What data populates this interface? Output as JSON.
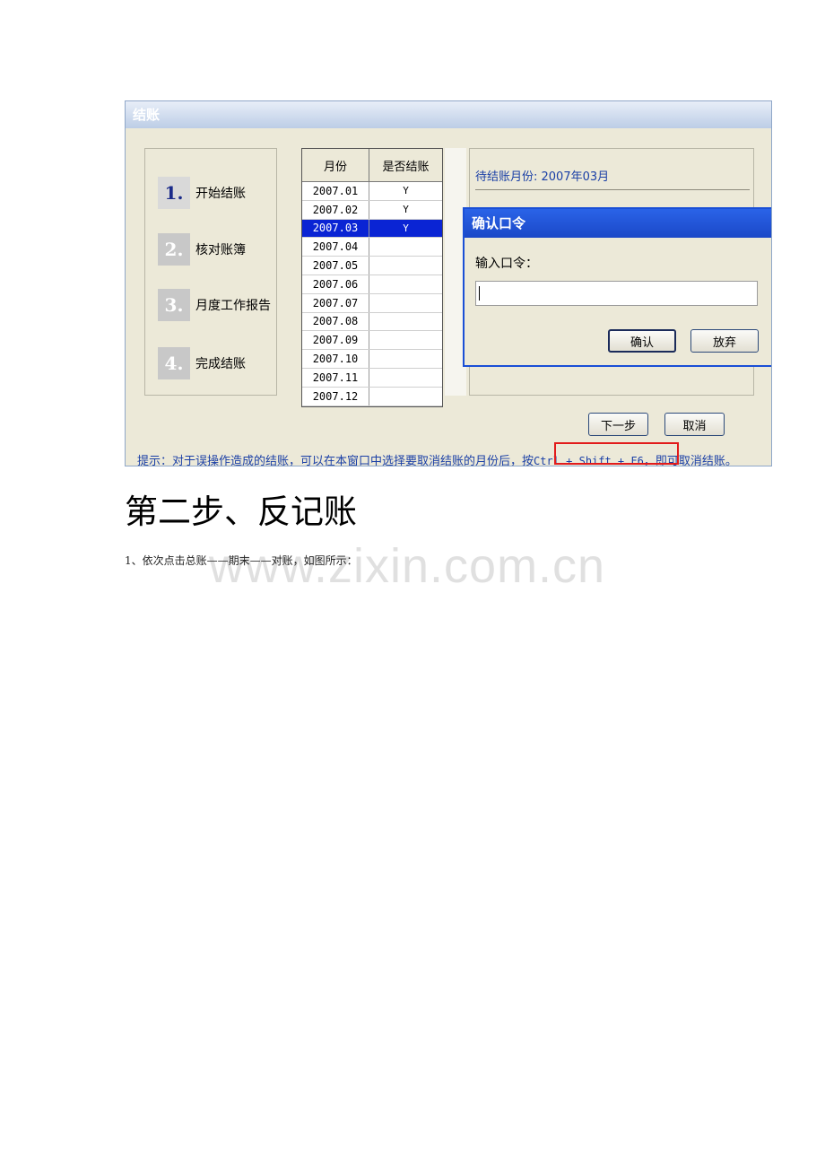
{
  "window": {
    "title": "结账",
    "steps": [
      {
        "num": "1.",
        "label": "开始结账",
        "active": true
      },
      {
        "num": "2.",
        "label": "核对账簿",
        "active": false
      },
      {
        "num": "3.",
        "label": "月度工作报告",
        "active": false
      },
      {
        "num": "4.",
        "label": "完成结账",
        "active": false
      }
    ],
    "table": {
      "headers": [
        "月份",
        "是否结账"
      ],
      "rows": [
        {
          "month": "2007.01",
          "closed": "Y"
        },
        {
          "month": "2007.02",
          "closed": "Y"
        },
        {
          "month": "2007.03",
          "closed": "Y"
        },
        {
          "month": "2007.04",
          "closed": ""
        },
        {
          "month": "2007.05",
          "closed": ""
        },
        {
          "month": "2007.06",
          "closed": ""
        },
        {
          "month": "2007.07",
          "closed": ""
        },
        {
          "month": "2007.08",
          "closed": ""
        },
        {
          "month": "2007.09",
          "closed": ""
        },
        {
          "month": "2007.10",
          "closed": ""
        },
        {
          "month": "2007.11",
          "closed": ""
        },
        {
          "month": "2007.12",
          "closed": ""
        }
      ],
      "selected_month": "2007.03"
    },
    "pending_month": "待结账月份: 2007年03月",
    "next_button": "下一步",
    "cancel_button": "取消",
    "hint_prefix": "提示：对于误操作造成的结账，可以在本窗口中选择要取消结账的月份后，按",
    "hint_keys": "Ctrl + Shift + F6",
    "hint_suffix": "，即可取消结账。"
  },
  "dialog": {
    "title": "确认口令",
    "label": "输入口令：",
    "password_value": "",
    "confirm_button": "确认",
    "abandon_button": "放弃"
  },
  "document": {
    "heading": "第二步、反记账",
    "paragraph": "1、依次点击总账——期末——对账，如图所示：",
    "watermark": "www.zixin.com.cn"
  },
  "colors": {
    "selection": "#0a24d4",
    "hint_text": "#1a3fa6",
    "highlight_box": "#e21b1b",
    "dialog_title": "#1b48c8"
  }
}
